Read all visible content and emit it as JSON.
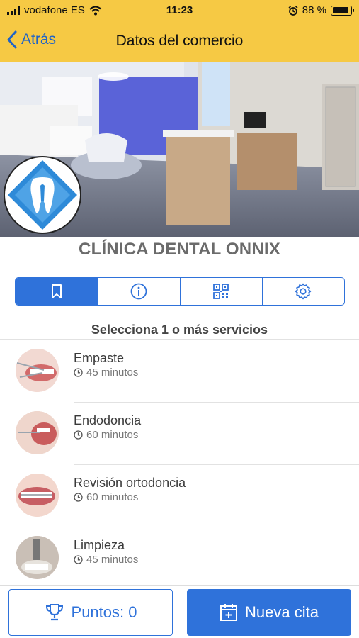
{
  "status_bar": {
    "carrier": "vodafone ES",
    "time": "11:23",
    "battery": "88 %",
    "battery_level": 0.88
  },
  "nav": {
    "back_label": "Atrás",
    "title": "Datos del comercio"
  },
  "clinic": {
    "name": "CLÍNICA DENTAL ONNIX"
  },
  "tabs": [
    {
      "icon": "bookmark-icon",
      "active": true
    },
    {
      "icon": "info-icon",
      "active": false
    },
    {
      "icon": "qr-code-icon",
      "active": false
    },
    {
      "icon": "gear-icon",
      "active": false
    }
  ],
  "services": {
    "heading": "Selecciona 1 o más servicios",
    "items": [
      {
        "name": "Empaste",
        "duration": "45 minutos"
      },
      {
        "name": "Endodoncia",
        "duration": "60 minutos"
      },
      {
        "name": "Revisión ortodoncia",
        "duration": "60 minutos"
      },
      {
        "name": "Limpieza",
        "duration": "45 minutos"
      }
    ]
  },
  "bottom": {
    "points_label": "Puntos: 0",
    "new_label": "Nueva cita"
  },
  "colors": {
    "nav_bg": "#f6c944",
    "accent": "#2f72da",
    "back_link": "#1f63c7"
  }
}
